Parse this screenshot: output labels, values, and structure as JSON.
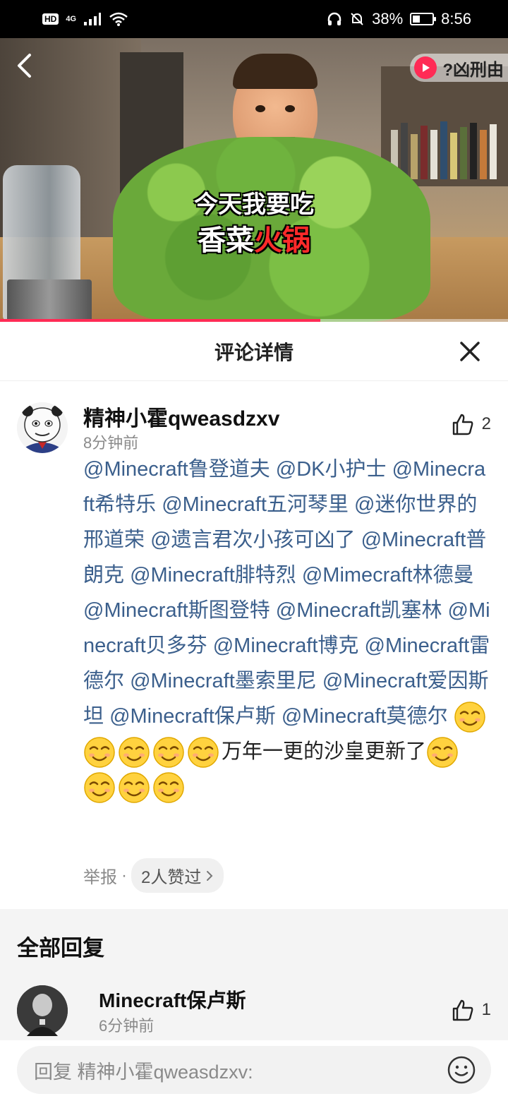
{
  "status_bar": {
    "hd": "HD",
    "network": "4G",
    "battery_text": "38%",
    "battery_level": 0.38,
    "time": "8:56"
  },
  "video": {
    "caption_line1": "今天我要吃",
    "caption_line2_a": "香菜",
    "caption_line2_b": "火锅",
    "chip_text": "?凶刑由",
    "progress": 0.63,
    "accent_color": "#ff2b55"
  },
  "header": {
    "title": "评论详情"
  },
  "comment": {
    "author": "精神小霍qweasdzxv",
    "time": "8分钟前",
    "like_count": "2",
    "mentions": [
      "@Minecraft鲁登道夫",
      "@DK小护士",
      "@Minecraft希特乐",
      "@Minecraft五河琴里",
      "@迷你世界的邢道荣",
      "@遗言君次小孩可凶了",
      "@Minecraft普朗克",
      "@Minecraft腓特烈",
      "@Mimecraft林德曼",
      "@Minecraft斯图登特",
      "@Minecraft凯塞林",
      "@Minecraft贝多芬",
      "@Minecraft博克",
      "@Minecraft雷德尔",
      "@Minecraft墨索里尼",
      "@Minecraft爱因斯坦",
      "@Minecraft保卢斯",
      "@Minecraft莫德尔"
    ],
    "text": "万年一更的沙皇更新了",
    "emoji_name": "smirk-emoji",
    "emoji_count_before": 5,
    "emoji_count_after": 4,
    "report": "举报",
    "separator": "·",
    "liked_by": "2人赞过",
    "mention_color": "#3b5f8c"
  },
  "replies": {
    "title": "全部回复",
    "items": [
      {
        "author": "Minecraft保卢斯",
        "time": "6分钟前",
        "like_count": "1"
      }
    ]
  },
  "input": {
    "placeholder": "回复 精神小霍qweasdzxv:"
  }
}
